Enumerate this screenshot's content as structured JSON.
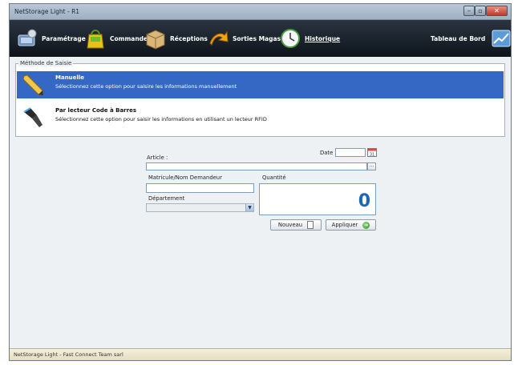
{
  "window": {
    "title": "NetStorage Light - R1"
  },
  "toolbar": {
    "items": [
      {
        "label": "Paramétrage",
        "icon": "settings-pc-icon"
      },
      {
        "label": "Commandes",
        "icon": "shopping-bag-icon"
      },
      {
        "label": "Réceptions",
        "icon": "box-icon"
      },
      {
        "label": "Sorties Magasin",
        "icon": "exit-arrow-icon"
      },
      {
        "label": "Historique",
        "icon": "clock-icon"
      },
      {
        "label": "Tableau de Bord",
        "icon": "chart-icon"
      }
    ]
  },
  "method": {
    "legend": "Méthode de Saisie",
    "options": [
      {
        "title": "Manuelle",
        "desc": "Sélectionnez cette option pour saisire les informations manuellement",
        "icon": "pencil-icon",
        "selected": true
      },
      {
        "title": "Par lecteur Code à Barres",
        "desc": "Sélectionnez cette option pour saisir les informations en utilisant un lecteur RFID",
        "icon": "barcode-scanner-icon",
        "selected": false
      }
    ]
  },
  "form": {
    "date_label": "Date",
    "article_label": "Article :",
    "matricule_label": "Matricule/Nom Demandeur",
    "quantite_label": "Quantité",
    "departement_label": "Département",
    "quantity_value": "0",
    "dots_label": "...",
    "nouveau_label": "Nouveau",
    "appliquer_label": "Appliquer"
  },
  "status": {
    "text": "NetStorage Light - Fast Connect Team sarl"
  },
  "colors": {
    "selection": "#3468c4",
    "toolbar": "#0e141b",
    "quantity": "#1f66b5"
  }
}
